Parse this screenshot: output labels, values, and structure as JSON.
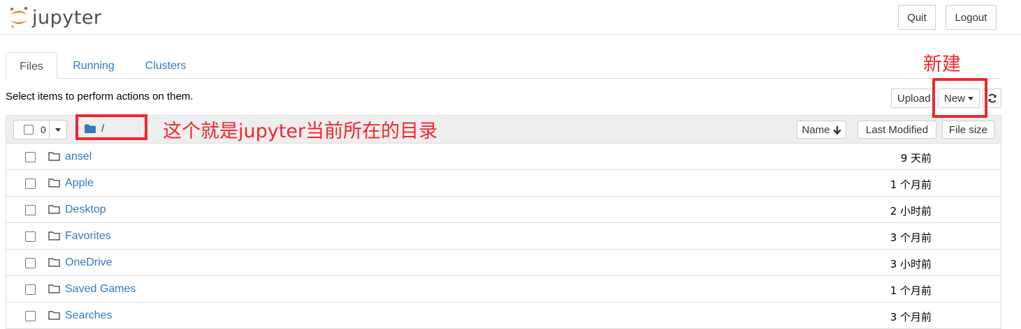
{
  "app": {
    "logo_text": "jupyter"
  },
  "header": {
    "quit_label": "Quit",
    "logout_label": "Logout"
  },
  "tabs": [
    {
      "label": "Files",
      "active": true
    },
    {
      "label": "Running",
      "active": false
    },
    {
      "label": "Clusters",
      "active": false
    }
  ],
  "help_text": "Select items to perform actions on them.",
  "toolbar": {
    "upload_label": "Upload",
    "new_label": "New"
  },
  "list": {
    "selected_count": "0",
    "breadcrumb_path": "/",
    "sort_name": "Name",
    "sort_modified": "Last Modified",
    "sort_size": "File size",
    "items": [
      {
        "name": "ansel",
        "modified": "9 天前"
      },
      {
        "name": "Apple",
        "modified": "1 个月前"
      },
      {
        "name": "Desktop",
        "modified": "2 小时前"
      },
      {
        "name": "Favorites",
        "modified": "3 个月前"
      },
      {
        "name": "OneDrive",
        "modified": "3 小时前"
      },
      {
        "name": "Saved Games",
        "modified": "1 个月前"
      },
      {
        "name": "Searches",
        "modified": "3 个月前"
      }
    ]
  },
  "annotations": {
    "new_note": "新建",
    "path_note": "这个就是jupyter当前所在的目录",
    "color": "#f0262d"
  },
  "colors": {
    "link": "#337ab7",
    "logo_orange": "#f37726"
  }
}
